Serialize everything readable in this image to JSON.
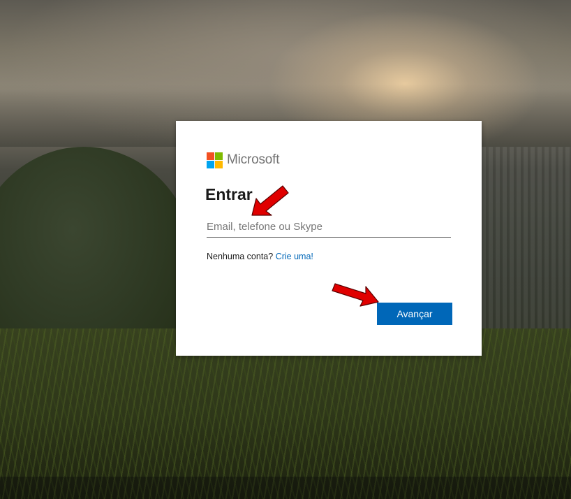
{
  "brand": {
    "name": "Microsoft",
    "logo_colors": [
      "#f25022",
      "#7fba00",
      "#00a4ef",
      "#ffb900"
    ]
  },
  "signin": {
    "title": "Entrar",
    "email_placeholder": "Email, telefone ou Skype",
    "email_value": "",
    "no_account_text": "Nenhuma conta?",
    "create_link": "Crie uma!",
    "next_button": "Avançar"
  },
  "colors": {
    "accent": "#0067b8",
    "annotation_arrow": "#e00000"
  }
}
